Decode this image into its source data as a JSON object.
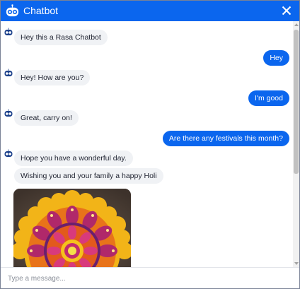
{
  "header": {
    "title": "Chatbot",
    "accent_color": "#0b66ee",
    "logo_icon": "robot-face-icon",
    "close_icon": "close-icon"
  },
  "messages": [
    {
      "sender": "bot",
      "text": "Hey this a Rasa Chatbot"
    },
    {
      "sender": "user",
      "text": "Hey"
    },
    {
      "sender": "bot",
      "text": "Hey! How are you?"
    },
    {
      "sender": "user",
      "text": "I'm good"
    },
    {
      "sender": "bot",
      "text": "Great, carry on!"
    },
    {
      "sender": "user",
      "text": "Are there any festivals this month?"
    },
    {
      "sender": "bot",
      "text": "Hope you have a wonderful day."
    },
    {
      "sender": "bot",
      "text": "Wishing you and your family a happy Holi"
    },
    {
      "sender": "bot",
      "type": "image",
      "image_subject": "rangoli-mandala"
    }
  ],
  "composer": {
    "placeholder": "Type a message..."
  },
  "colors": {
    "bot_bubble": "#f0f2f5",
    "user_bubble": "#0b66ee"
  }
}
